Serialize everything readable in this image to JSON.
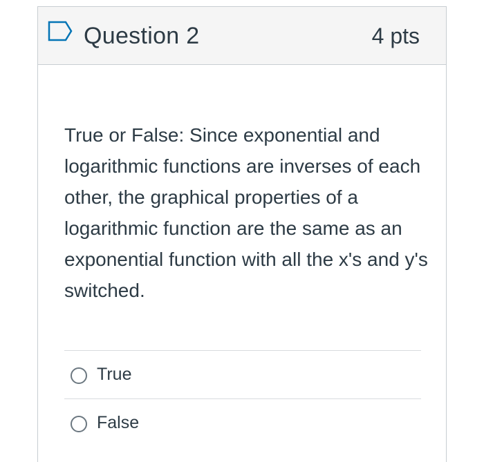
{
  "question": {
    "title": "Question 2",
    "points": "4 pts",
    "text": "True or False: Since exponential and logarithmic functions are inverses of each other, the graphical properties of a logarithmic function are the same as an exponential function with all the x's and y's switched.",
    "flag_icon": "flag-icon"
  },
  "answers": [
    {
      "label": "True",
      "selected": false
    },
    {
      "label": "False",
      "selected": false
    }
  ],
  "colors": {
    "text": "#2d3b45",
    "header_bg": "#f5f5f5",
    "border": "#c7cdd1",
    "flag_accent": "#0374b5"
  }
}
